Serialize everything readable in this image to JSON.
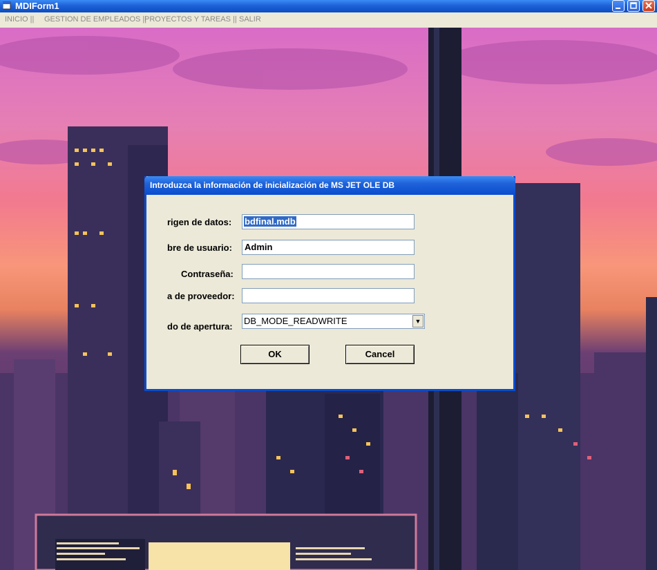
{
  "window": {
    "title": "MDIForm1"
  },
  "menu": {
    "items": [
      "INICIO ||",
      "GESTION DE EMPLEADOS ||",
      "PROYECTOS Y TAREAS ||",
      "SALIR"
    ]
  },
  "dialog": {
    "title": "Introduzca la información de inicialización de MS JET OLE DB",
    "fields": [
      {
        "label": "rigen de datos:",
        "value": "bdfinal.mdb"
      },
      {
        "label": "bre de usuario:",
        "value": "Admin"
      },
      {
        "label": "Contraseña:",
        "value": ""
      },
      {
        "label": "a de proveedor:",
        "value": ""
      }
    ],
    "mode": {
      "label": "do de apertura:",
      "value": "DB_MODE_READWRITE"
    },
    "ok_label": "OK",
    "cancel_label": "Cancel"
  },
  "colors": {
    "title_blue": "#0a4ccf",
    "dialog_bg": "#ece9d8",
    "selection": "#316ac5"
  }
}
